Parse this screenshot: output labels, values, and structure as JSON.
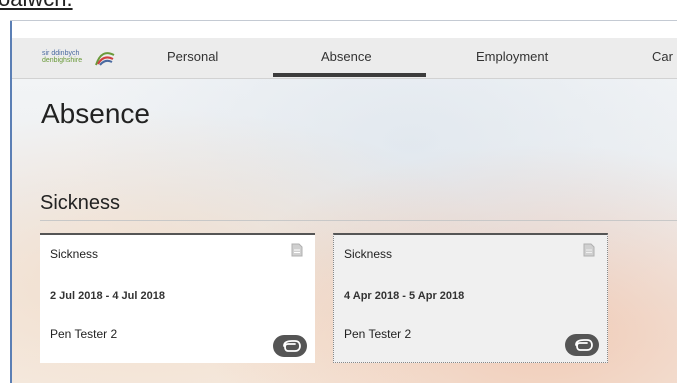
{
  "header_fragment": "oaiwch.",
  "logo": {
    "line1": "sir ddinbych",
    "line2": "denbighshire",
    "icon": "council-logo-icon"
  },
  "nav": {
    "tabs": [
      {
        "label": "Personal"
      },
      {
        "label": "Absence",
        "active": true
      },
      {
        "label": "Employment"
      },
      {
        "label": "Car"
      }
    ]
  },
  "page": {
    "title": "Absence",
    "section_title": "Sickness"
  },
  "cards": [
    {
      "type": "Sickness",
      "dates": "2 Jul 2018 - 4 Jul 2018",
      "person": "Pen Tester 2",
      "doc_icon": "document-icon",
      "attach_icon": "paperclip-icon"
    },
    {
      "type": "Sickness",
      "dates": "4 Apr 2018 - 5 Apr 2018",
      "person": "Pen Tester 2",
      "doc_icon": "document-icon",
      "attach_icon": "paperclip-icon"
    }
  ],
  "colors": {
    "frame_accent": "#5b7fb5",
    "nav_background": "#ececec",
    "active_tab_underline": "#3c3c3c",
    "badge": "#555555"
  }
}
